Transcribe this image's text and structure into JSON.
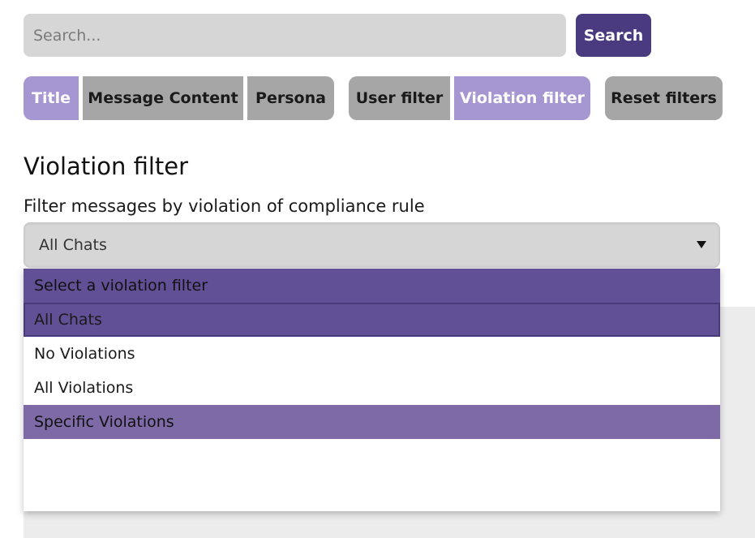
{
  "search": {
    "placeholder": "Search...",
    "button_label": "Search"
  },
  "tabs": {
    "title": "Title",
    "message_content": "Message Content",
    "persona": "Persona",
    "user_filter": "User filter",
    "violation_filter": "Violation filter",
    "reset_filters": "Reset filters"
  },
  "section": {
    "title": "Violation filter",
    "label": "Filter messages by violation of compliance rule"
  },
  "select": {
    "value": "All Chats",
    "options": [
      "Select a violation filter",
      "All Chats",
      "No Violations",
      "All Violations",
      "Specific Violations"
    ]
  },
  "colors": {
    "accent_dark": "#4a3a80",
    "accent_light": "#a696d2",
    "option_highlight": "#615095",
    "option_hover": "#7e6aa6"
  },
  "icons": {
    "select_arrow": "chevron-down-icon"
  }
}
